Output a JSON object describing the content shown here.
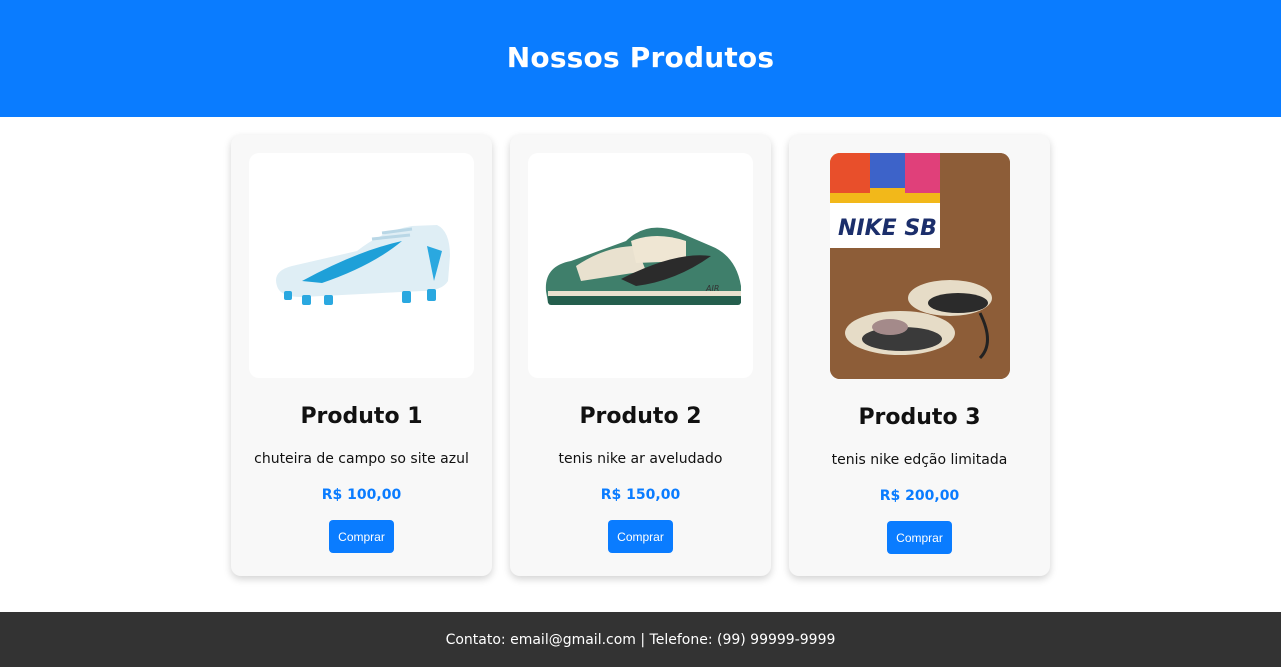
{
  "header": {
    "title": "Nossos Produtos"
  },
  "products": [
    {
      "image": "soccer-cleat-light-blue-icon",
      "name": "Produto 1",
      "description": "chuteira de campo so site azul",
      "price": "R$ 100,00",
      "button": "Comprar"
    },
    {
      "image": "green-sneaker-air-icon",
      "name": "Produto 2",
      "description": "tenis nike ar aveludado",
      "price": "R$ 150,00",
      "button": "Comprar"
    },
    {
      "image": "nike-sb-box-sneakers-photo",
      "name": "Produto 3",
      "description": "tenis nike edção limitada",
      "price": "R$ 200,00",
      "button": "Comprar",
      "photo_text": "NIKE SB"
    }
  ],
  "footer": {
    "text": "Contato: email@gmail.com | Telefone: (99) 99999-9999"
  },
  "colors": {
    "accent": "#0a7cff",
    "footer": "#333333",
    "card": "#f8f8f8"
  }
}
